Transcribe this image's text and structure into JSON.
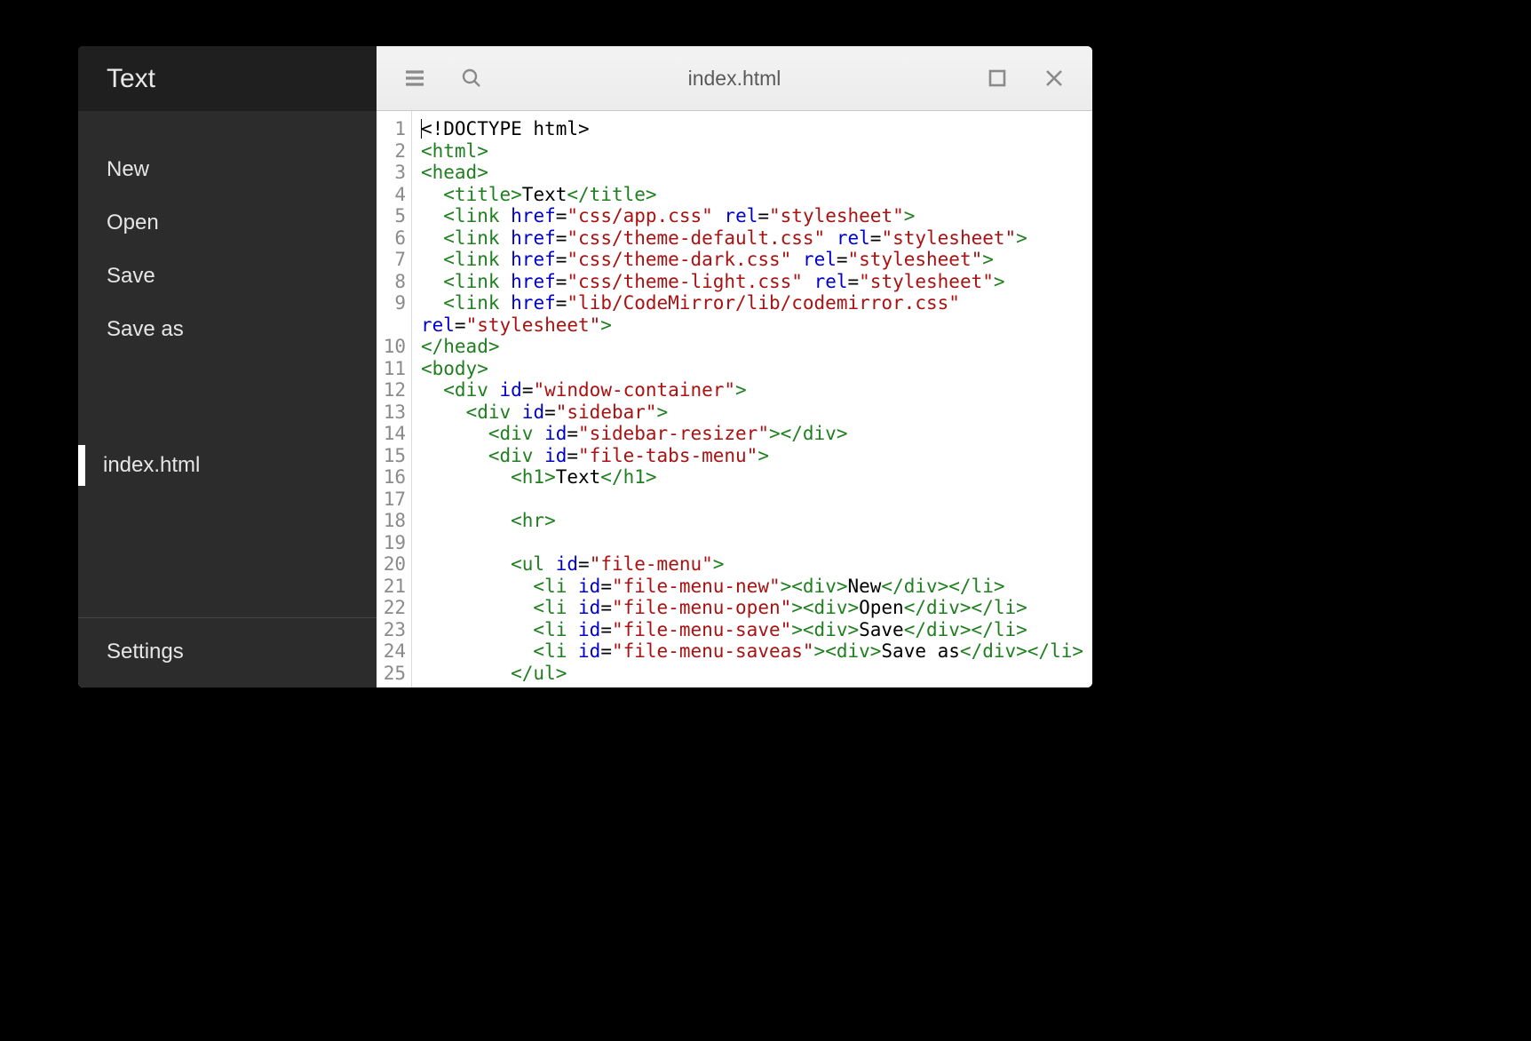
{
  "sidebar": {
    "title": "Text",
    "menu": {
      "new": "New",
      "open": "Open",
      "save": "Save",
      "saveas": "Save as"
    },
    "tabs": [
      {
        "label": "index.html",
        "active": true
      }
    ],
    "settings": "Settings"
  },
  "tabbar": {
    "filename": "index.html"
  },
  "code": {
    "firstLine": 1,
    "lastLine": 25,
    "lines": [
      [
        [
          "text",
          "<!DOCTYPE html>"
        ]
      ],
      [
        [
          "kw",
          "<html>"
        ]
      ],
      [
        [
          "kw",
          "<head>"
        ]
      ],
      [
        [
          "text",
          "  "
        ],
        [
          "kw",
          "<title>"
        ],
        [
          "text",
          "Text"
        ],
        [
          "kw",
          "</title>"
        ]
      ],
      [
        [
          "text",
          "  "
        ],
        [
          "kw",
          "<link"
        ],
        [
          "text",
          " "
        ],
        [
          "attr",
          "href"
        ],
        [
          "text",
          "="
        ],
        [
          "str",
          "\"css/app.css\""
        ],
        [
          "text",
          " "
        ],
        [
          "attr",
          "rel"
        ],
        [
          "text",
          "="
        ],
        [
          "str",
          "\"stylesheet\""
        ],
        [
          "kw",
          ">"
        ]
      ],
      [
        [
          "text",
          "  "
        ],
        [
          "kw",
          "<link"
        ],
        [
          "text",
          " "
        ],
        [
          "attr",
          "href"
        ],
        [
          "text",
          "="
        ],
        [
          "str",
          "\"css/theme-default.css\""
        ],
        [
          "text",
          " "
        ],
        [
          "attr",
          "rel"
        ],
        [
          "text",
          "="
        ],
        [
          "str",
          "\"stylesheet\""
        ],
        [
          "kw",
          ">"
        ]
      ],
      [
        [
          "text",
          "  "
        ],
        [
          "kw",
          "<link"
        ],
        [
          "text",
          " "
        ],
        [
          "attr",
          "href"
        ],
        [
          "text",
          "="
        ],
        [
          "str",
          "\"css/theme-dark.css\""
        ],
        [
          "text",
          " "
        ],
        [
          "attr",
          "rel"
        ],
        [
          "text",
          "="
        ],
        [
          "str",
          "\"stylesheet\""
        ],
        [
          "kw",
          ">"
        ]
      ],
      [
        [
          "text",
          "  "
        ],
        [
          "kw",
          "<link"
        ],
        [
          "text",
          " "
        ],
        [
          "attr",
          "href"
        ],
        [
          "text",
          "="
        ],
        [
          "str",
          "\"css/theme-light.css\""
        ],
        [
          "text",
          " "
        ],
        [
          "attr",
          "rel"
        ],
        [
          "text",
          "="
        ],
        [
          "str",
          "\"stylesheet\""
        ],
        [
          "kw",
          ">"
        ]
      ],
      [
        [
          "text",
          "  "
        ],
        [
          "kw",
          "<link"
        ],
        [
          "text",
          " "
        ],
        [
          "attr",
          "href"
        ],
        [
          "text",
          "="
        ],
        [
          "str",
          "\"lib/CodeMirror/lib/codemirror.css\""
        ]
      ],
      [
        [
          "attr",
          "rel"
        ],
        [
          "text",
          "="
        ],
        [
          "str",
          "\"stylesheet\""
        ],
        [
          "kw",
          ">"
        ]
      ],
      [
        [
          "kw",
          "</head>"
        ]
      ],
      [
        [
          "kw",
          "<body>"
        ]
      ],
      [
        [
          "text",
          "  "
        ],
        [
          "kw",
          "<div"
        ],
        [
          "text",
          " "
        ],
        [
          "attr",
          "id"
        ],
        [
          "text",
          "="
        ],
        [
          "str",
          "\"window-container\""
        ],
        [
          "kw",
          ">"
        ]
      ],
      [
        [
          "text",
          "    "
        ],
        [
          "kw",
          "<div"
        ],
        [
          "text",
          " "
        ],
        [
          "attr",
          "id"
        ],
        [
          "text",
          "="
        ],
        [
          "str",
          "\"sidebar\""
        ],
        [
          "kw",
          ">"
        ]
      ],
      [
        [
          "text",
          "      "
        ],
        [
          "kw",
          "<div"
        ],
        [
          "text",
          " "
        ],
        [
          "attr",
          "id"
        ],
        [
          "text",
          "="
        ],
        [
          "str",
          "\"sidebar-resizer\""
        ],
        [
          "kw",
          "></div>"
        ]
      ],
      [
        [
          "text",
          "      "
        ],
        [
          "kw",
          "<div"
        ],
        [
          "text",
          " "
        ],
        [
          "attr",
          "id"
        ],
        [
          "text",
          "="
        ],
        [
          "str",
          "\"file-tabs-menu\""
        ],
        [
          "kw",
          ">"
        ]
      ],
      [
        [
          "text",
          "        "
        ],
        [
          "kw",
          "<h1>"
        ],
        [
          "text",
          "Text"
        ],
        [
          "kw",
          "</h1>"
        ]
      ],
      [],
      [
        [
          "text",
          "        "
        ],
        [
          "kw",
          "<hr>"
        ]
      ],
      [],
      [
        [
          "text",
          "        "
        ],
        [
          "kw",
          "<ul"
        ],
        [
          "text",
          " "
        ],
        [
          "attr",
          "id"
        ],
        [
          "text",
          "="
        ],
        [
          "str",
          "\"file-menu\""
        ],
        [
          "kw",
          ">"
        ]
      ],
      [
        [
          "text",
          "          "
        ],
        [
          "kw",
          "<li"
        ],
        [
          "text",
          " "
        ],
        [
          "attr",
          "id"
        ],
        [
          "text",
          "="
        ],
        [
          "str",
          "\"file-menu-new\""
        ],
        [
          "kw",
          "><div>"
        ],
        [
          "text",
          "New"
        ],
        [
          "kw",
          "</div></li>"
        ]
      ],
      [
        [
          "text",
          "          "
        ],
        [
          "kw",
          "<li"
        ],
        [
          "text",
          " "
        ],
        [
          "attr",
          "id"
        ],
        [
          "text",
          "="
        ],
        [
          "str",
          "\"file-menu-open\""
        ],
        [
          "kw",
          "><div>"
        ],
        [
          "text",
          "Open"
        ],
        [
          "kw",
          "</div></li>"
        ]
      ],
      [
        [
          "text",
          "          "
        ],
        [
          "kw",
          "<li"
        ],
        [
          "text",
          " "
        ],
        [
          "attr",
          "id"
        ],
        [
          "text",
          "="
        ],
        [
          "str",
          "\"file-menu-save\""
        ],
        [
          "kw",
          "><div>"
        ],
        [
          "text",
          "Save"
        ],
        [
          "kw",
          "</div></li>"
        ]
      ],
      [
        [
          "text",
          "          "
        ],
        [
          "kw",
          "<li"
        ],
        [
          "text",
          " "
        ],
        [
          "attr",
          "id"
        ],
        [
          "text",
          "="
        ],
        [
          "str",
          "\"file-menu-saveas\""
        ],
        [
          "kw",
          "><div>"
        ],
        [
          "text",
          "Save as"
        ],
        [
          "kw",
          "</div></li>"
        ]
      ],
      [
        [
          "text",
          "        "
        ],
        [
          "kw",
          "</ul>"
        ]
      ]
    ],
    "lineMap": [
      1,
      2,
      3,
      4,
      5,
      6,
      7,
      8,
      9,
      9,
      10,
      11,
      12,
      13,
      14,
      15,
      16,
      17,
      18,
      19,
      20,
      21,
      22,
      23,
      24,
      25
    ]
  }
}
